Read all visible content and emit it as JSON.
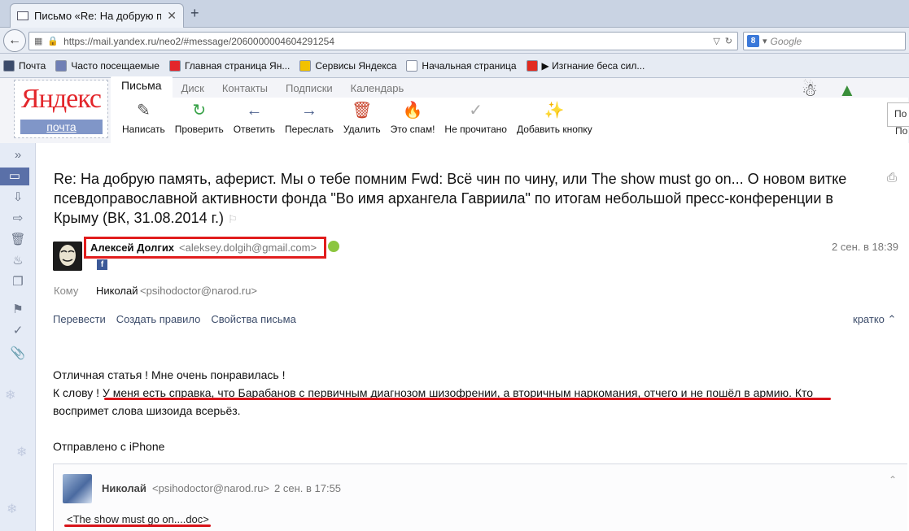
{
  "browser": {
    "tab_title": "Письмо «Re: На добрую п...",
    "tab_close": "✕",
    "new_tab": "+",
    "url": "https://mail.yandex.ru/neo2/#message/2060000004604291254",
    "search_placeholder": "Google",
    "search_engine_badge": "8",
    "bookmarks": [
      {
        "label": "Почта",
        "icon": "mail-icon",
        "color": "#3a4a6a"
      },
      {
        "label": "Часто посещаемые",
        "icon": "star-icon",
        "color": "#6f7fb5"
      },
      {
        "label": "Главная страница Ян...",
        "icon": "yandex-icon",
        "color": "#e3262b"
      },
      {
        "label": "Сервисы Яндекса",
        "icon": "folder-icon",
        "color": "#f2c200"
      },
      {
        "label": "Начальная страница",
        "icon": "page-icon",
        "color": "#ffffff"
      },
      {
        "label": "▶ Изгнание беса сил...",
        "icon": "youtube-icon",
        "color": "#e22b1f"
      }
    ]
  },
  "mail": {
    "logo_text": "Яндекс",
    "logo_sub": "почта",
    "service_tabs": [
      "Письма",
      "Диск",
      "Контакты",
      "Подписки",
      "Календарь"
    ],
    "toolbar": [
      {
        "label": "Написать",
        "icon": "compose-icon",
        "glyph": "✎",
        "color": "#555"
      },
      {
        "label": "Проверить",
        "icon": "refresh-icon",
        "glyph": "↻",
        "color": "#36a146"
      },
      {
        "label": "Ответить",
        "icon": "reply-icon",
        "glyph": "←",
        "color": "#4a5f8c"
      },
      {
        "label": "Переслать",
        "icon": "forward-icon",
        "glyph": "→",
        "color": "#4a5f8c"
      },
      {
        "label": "Удалить",
        "icon": "trash-icon",
        "glyph": "🗑",
        "color": "#c8432b"
      },
      {
        "label": "Это спам!",
        "icon": "flame-icon",
        "glyph": "🔥",
        "color": "#f08a00"
      },
      {
        "label": "Не прочитано",
        "icon": "check-icon",
        "glyph": "✓",
        "color": "#aaa"
      },
      {
        "label": "Добавить кнопку",
        "icon": "magic-wand-icon",
        "glyph": "✨",
        "color": "#c8432b"
      }
    ],
    "right_box_top": "По",
    "right_box_bottom": "По"
  },
  "message": {
    "subject": "Re: На добрую память, аферист. Мы о тебе помним Fwd: Всё чин по чину, или The show must go on... О новом витке псевдоправославной активности фонда \"Во имя архангела Гавриила\" по итогам небольшой пресс-конференции в Крыму (ВК, 31.08.2014 г.)",
    "subject_flag": "⚐",
    "sender_name": "Алексей Долгих",
    "sender_email": "<aleksey.dolgih@gmail.com>",
    "date": "2 сен. в 18:39",
    "to_label": "Кому",
    "to_name": "Николай",
    "to_email": "<psihodoctor@narod.ru>",
    "actions": [
      "Перевести",
      "Создать правило",
      "Свойства письма"
    ],
    "brief": "кратко",
    "fb_letter": "f",
    "body": {
      "line1": "Отличная статья ! Мне очень понравилась !",
      "line2a": "К слову ! ",
      "line2b": "У меня есть справка, что Барабанов с первичным диагнозом шизофрении, а вторичным наркомания, отчего и не пошёл в армию.",
      "line2c": " Кто",
      "line3": "воспримет слова шизоида всерьёз.",
      "signature": "Отправлено с iPhone"
    },
    "highlight_color": "#d8141a"
  },
  "quoted": {
    "name": "Николай",
    "email": "<psihodoctor@narod.ru>",
    "date": "2 сен. в 17:55",
    "attachment": "<The show must go on....doc>"
  }
}
